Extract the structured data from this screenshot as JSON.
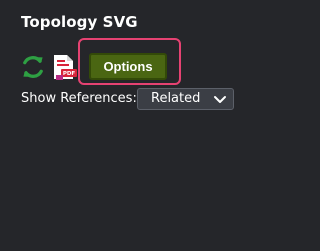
{
  "panel": {
    "title": "Topology SVG"
  },
  "toolbar": {
    "refresh_icon": "refresh-icon",
    "pdf_icon": "pdf-export-icon",
    "pdf_badge_text": "PDF",
    "options_label": "Options"
  },
  "references": {
    "label": "Show References:",
    "selected": "Related"
  },
  "colors": {
    "background": "#25262a",
    "options_button": "#4a6612",
    "highlight_border": "#e64272",
    "refresh_icon": "#2ea043",
    "pdf_icon_red": "#d8243a"
  }
}
